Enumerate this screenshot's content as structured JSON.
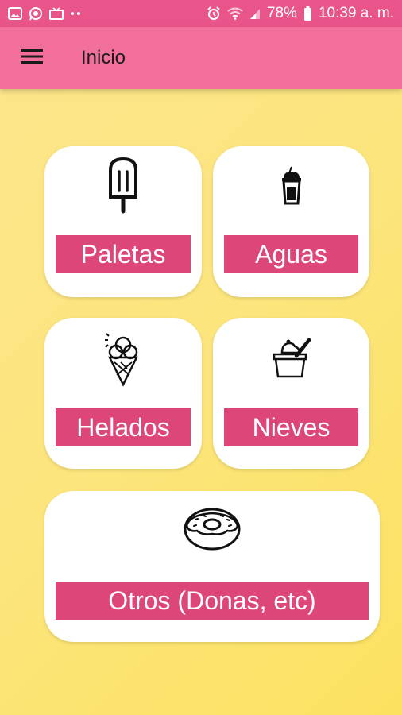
{
  "status_bar": {
    "battery": "78%",
    "time": "10:39 a. m.",
    "icons": [
      "image-icon",
      "whatsapp-icon",
      "tv-icon",
      "dots-icon",
      "alarm-icon",
      "wifi-icon",
      "signal-icon",
      "battery-icon"
    ]
  },
  "app_bar": {
    "title": "Inicio",
    "menu_icon": "hamburger-menu-icon"
  },
  "categories": [
    {
      "label": "Paletas",
      "icon": "popsicle-icon"
    },
    {
      "label": "Aguas",
      "icon": "drink-cup-icon"
    },
    {
      "label": "Helados",
      "icon": "ice-cream-cone-icon"
    },
    {
      "label": "Nieves",
      "icon": "sorbet-cup-icon"
    },
    {
      "label": "Otros (Donas, etc)",
      "icon": "donut-icon"
    }
  ],
  "colors": {
    "status_bar": "#e9558a",
    "app_bar": "#f36f9b",
    "label_bg": "#dc4678",
    "background": "#fce57c"
  }
}
